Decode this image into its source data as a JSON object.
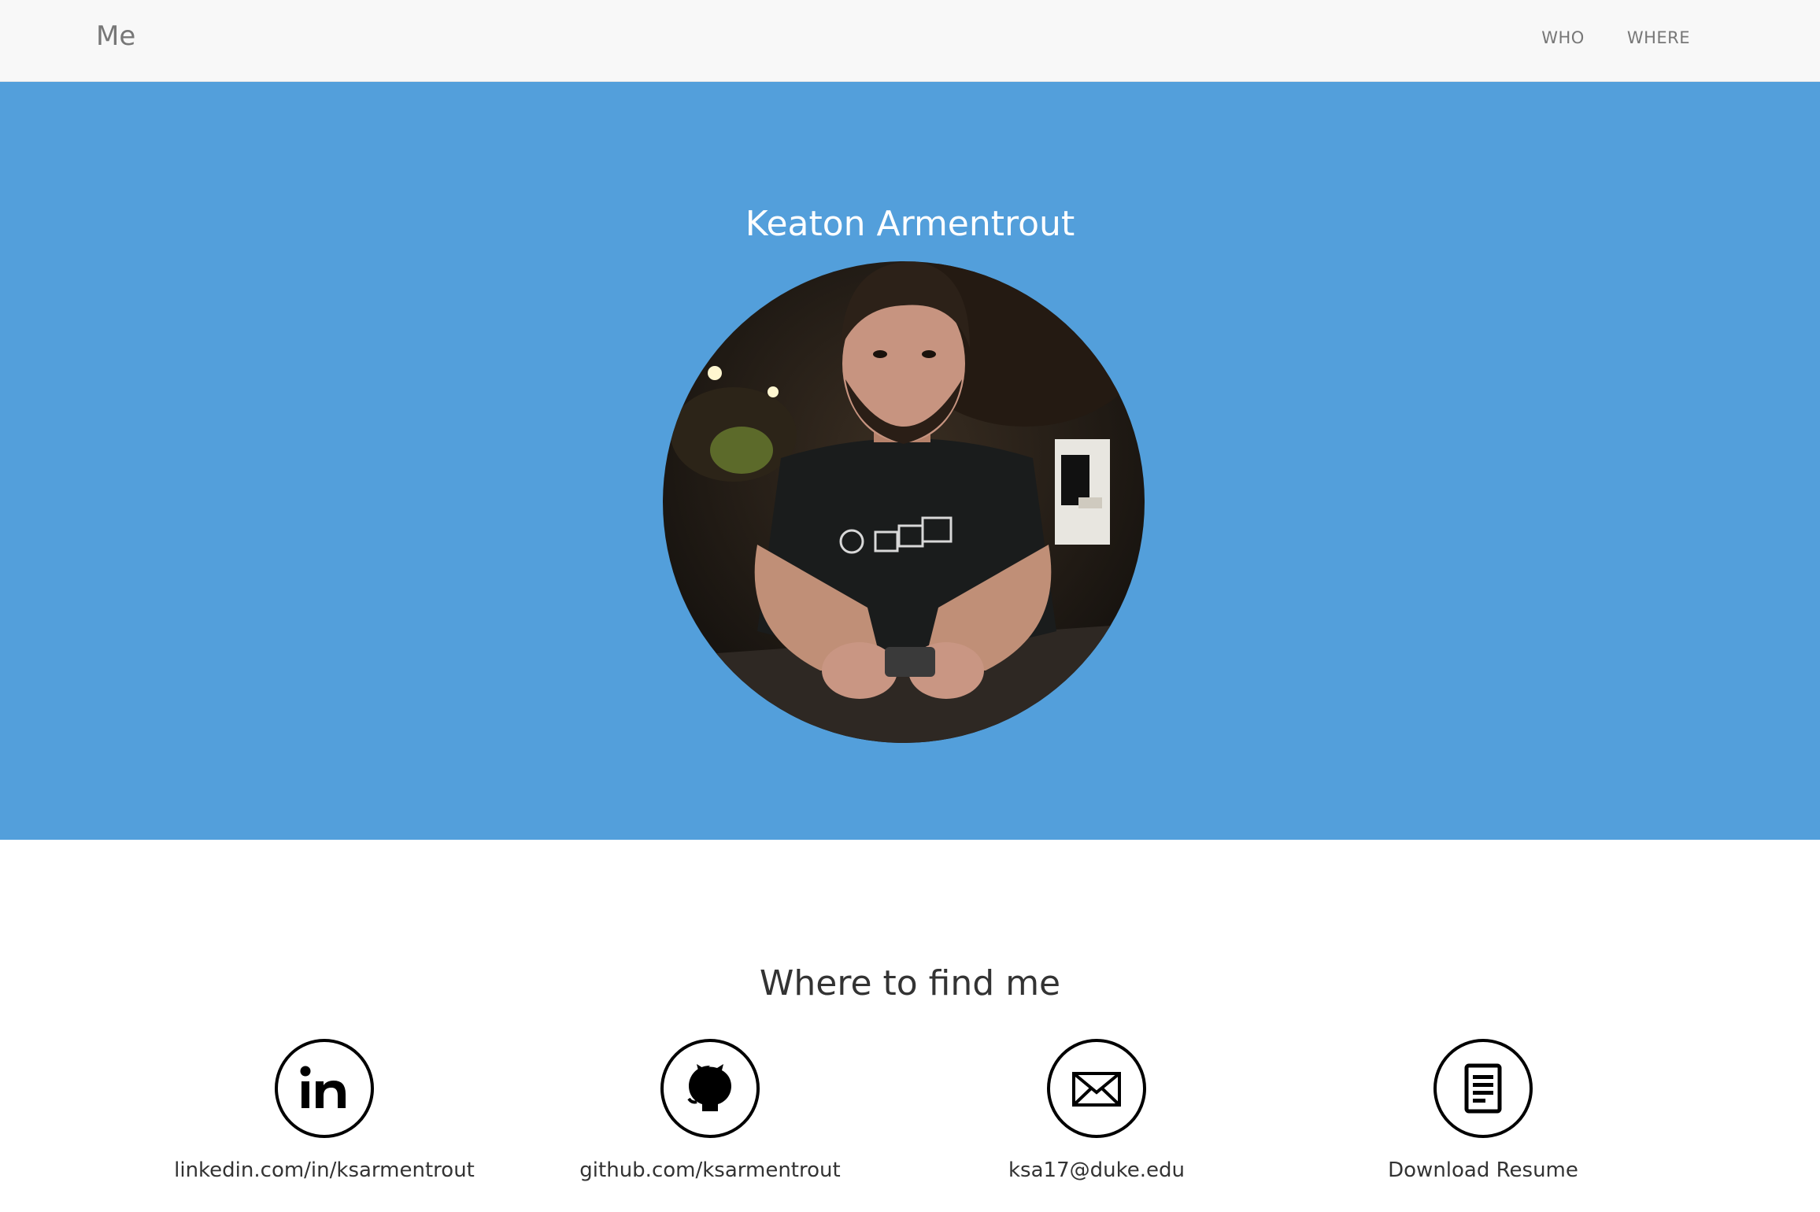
{
  "navbar": {
    "brand": "Me",
    "links": [
      {
        "label": "WHO"
      },
      {
        "label": "WHERE"
      }
    ]
  },
  "hero": {
    "name": "Keaton Armentrout",
    "photo_icon": "profile-photo"
  },
  "contact_section": {
    "title": "Where to find me",
    "items": [
      {
        "icon": "linkedin-icon",
        "label": "linkedin.com/in/ksarmentrout"
      },
      {
        "icon": "github-icon",
        "label": "github.com/ksarmentrout"
      },
      {
        "icon": "mail-icon",
        "label": "ksa17@duke.edu"
      },
      {
        "icon": "document-icon",
        "label": "Download Resume"
      }
    ]
  },
  "colors": {
    "hero_bg": "#539fdb",
    "navbar_bg": "#f8f8f8",
    "nav_text": "#777777",
    "body_text": "#333333"
  }
}
